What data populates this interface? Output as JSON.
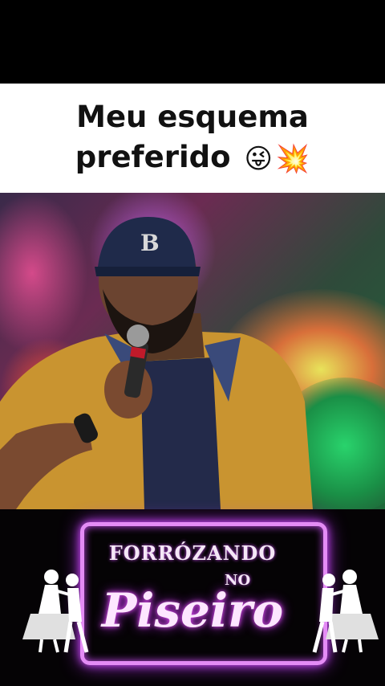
{
  "caption": {
    "line1": "Meu esquema",
    "line2": "preferido",
    "emoji1": "😜",
    "emoji2": "💥"
  },
  "logo": {
    "word1": "FORRÓZANDO",
    "word2": "NO",
    "word3": "Piseiro",
    "neon_color": "#e48cf5"
  },
  "photo": {
    "icon": "singer-photo"
  }
}
